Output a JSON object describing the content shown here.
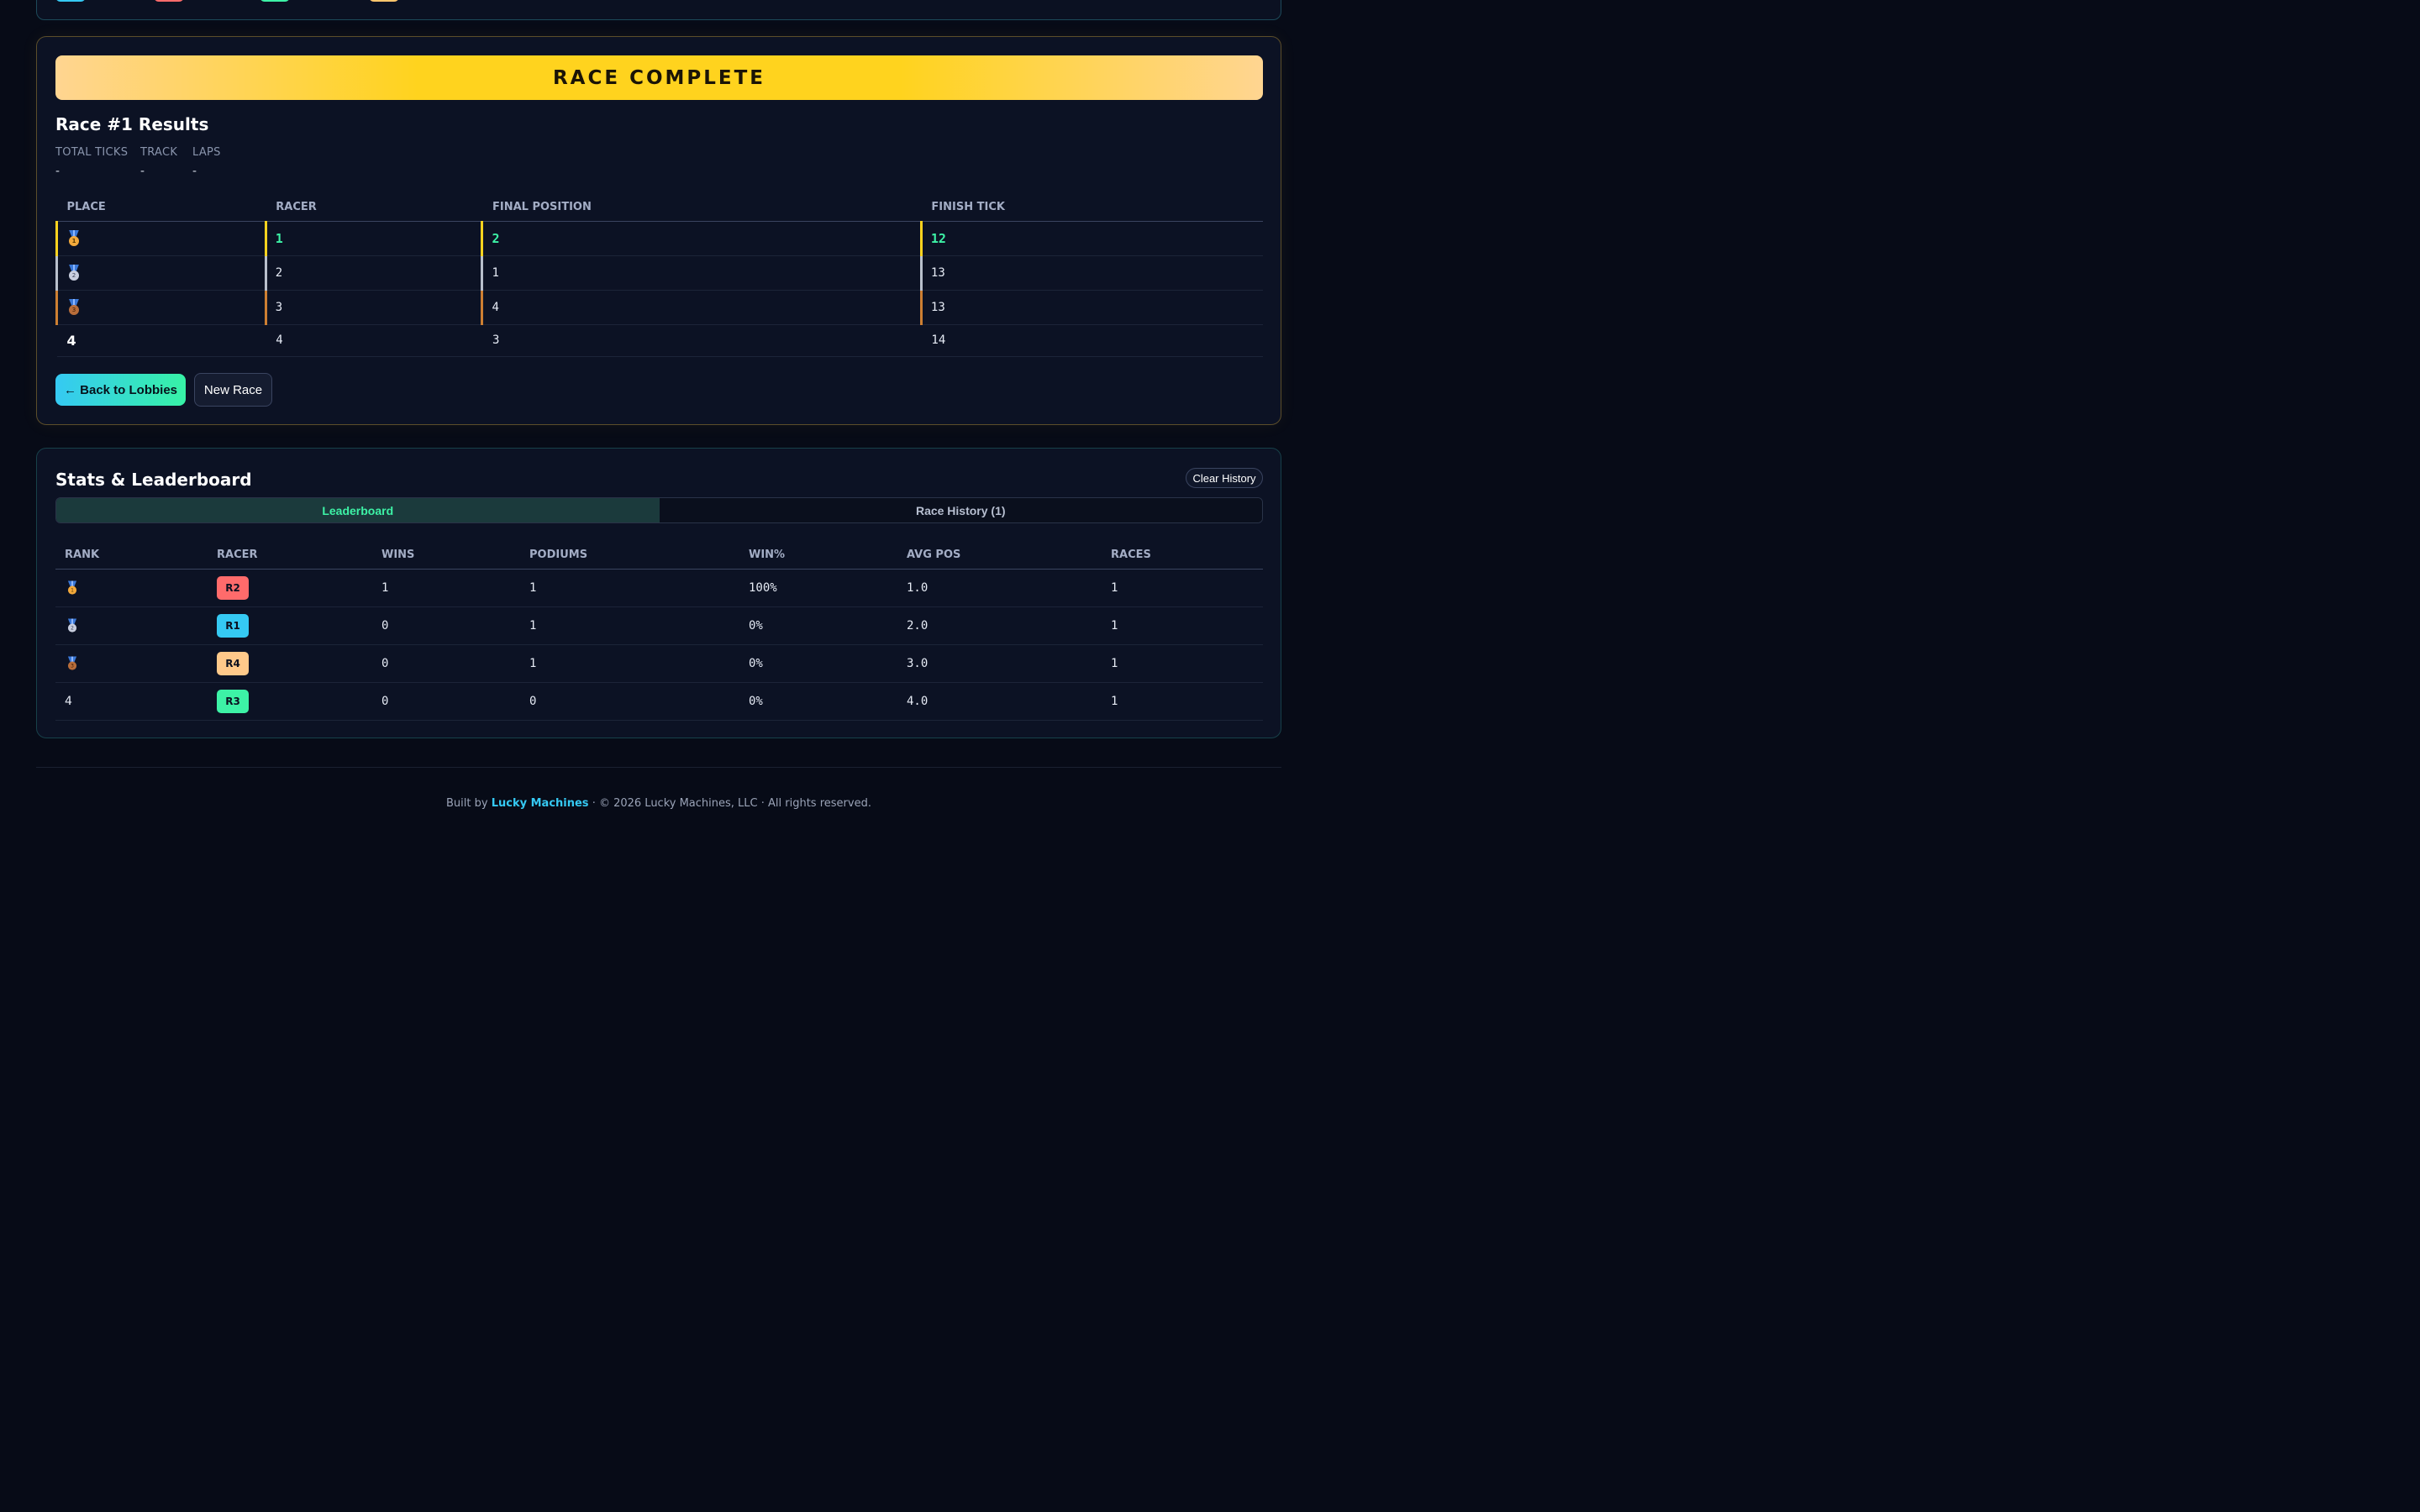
{
  "colors": {
    "accent_cyan": "#35c9f3",
    "accent_green": "#3df2a6",
    "gold": "#ffd31e",
    "silver": "#b9c0cc",
    "bronze": "#cd7f32"
  },
  "top_chips": [
    "#35c9f3",
    "#ff6b6b",
    "#3df2a6",
    "#ffc66d"
  ],
  "race": {
    "banner": "RACE COMPLETE",
    "title": "Race #1 Results",
    "meta": [
      {
        "label": "TOTAL TICKS",
        "value": "-"
      },
      {
        "label": "TRACK",
        "value": "-"
      },
      {
        "label": "LAPS",
        "value": "-"
      }
    ],
    "columns": [
      "PLACE",
      "RACER",
      "FINAL POSITION",
      "FINISH TICK"
    ],
    "rows": [
      {
        "place": "1",
        "icon": "gold-medal-icon",
        "racer": "1",
        "final_position": "2",
        "finish_tick": "12"
      },
      {
        "place": "2",
        "icon": "silver-medal-icon",
        "racer": "2",
        "final_position": "1",
        "finish_tick": "13"
      },
      {
        "place": "3",
        "icon": "bronze-medal-icon",
        "racer": "3",
        "final_position": "4",
        "finish_tick": "13"
      },
      {
        "place": "4",
        "icon": "",
        "racer": "4",
        "final_position": "3",
        "finish_tick": "14"
      }
    ],
    "back_button": "← Back to Lobbies",
    "new_race_button": "New Race"
  },
  "stats": {
    "title": "Stats & Leaderboard",
    "clear_button": "Clear History",
    "tabs": [
      {
        "label": "Leaderboard",
        "active": true
      },
      {
        "label": "Race History (1)",
        "active": false
      }
    ],
    "columns": [
      "RANK",
      "RACER",
      "WINS",
      "PODIUMS",
      "WIN%",
      "AVG POS",
      "RACES"
    ],
    "rows": [
      {
        "rank": "1",
        "icon": "gold-medal-icon",
        "racer": "R2",
        "color": "#ff6b6b",
        "wins": "1",
        "podiums": "1",
        "win_pct": "100%",
        "avg_pos": "1.0",
        "races": "1"
      },
      {
        "rank": "2",
        "icon": "silver-medal-icon",
        "racer": "R1",
        "color": "#35c9f3",
        "wins": "0",
        "podiums": "1",
        "win_pct": "0%",
        "avg_pos": "2.0",
        "races": "1"
      },
      {
        "rank": "3",
        "icon": "bronze-medal-icon",
        "racer": "R4",
        "color": "#ffc98a",
        "wins": "0",
        "podiums": "1",
        "win_pct": "0%",
        "avg_pos": "3.0",
        "races": "1"
      },
      {
        "rank": "4",
        "icon": "",
        "racer": "R3",
        "color": "#3df2a6",
        "wins": "0",
        "podiums": "0",
        "win_pct": "0%",
        "avg_pos": "4.0",
        "races": "1"
      }
    ]
  },
  "footer": {
    "prefix": "Built by",
    "brand": "Lucky Machines",
    "suffix": "· © 2026 Lucky Machines, LLC · All rights reserved."
  }
}
